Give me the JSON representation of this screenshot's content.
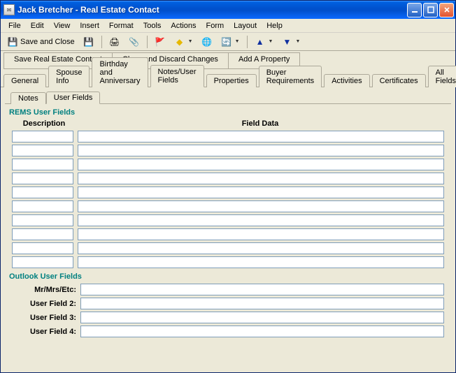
{
  "title": "Jack Bretcher - Real Estate Contact",
  "menu": [
    "File",
    "Edit",
    "View",
    "Insert",
    "Format",
    "Tools",
    "Actions",
    "Form",
    "Layout",
    "Help"
  ],
  "toolbar": {
    "save_close": "Save and Close"
  },
  "actions": {
    "save_contact": "Save Real Estate Contact",
    "close_discard": "Close and Discard Changes",
    "add_property": "Add A Property"
  },
  "tabs": [
    "General",
    "Spouse Info",
    "Birthday and Anniversary",
    "Notes/User Fields",
    "Properties",
    "Buyer Requirements",
    "Activities",
    "Certificates",
    "All Fields"
  ],
  "active_tab": "Notes/User Fields",
  "subtabs": [
    "Notes",
    "User Fields"
  ],
  "active_subtab": "User Fields",
  "rems": {
    "group_label": "REMS User Fields",
    "desc_header": "Description",
    "data_header": "Field Data",
    "rows": [
      {
        "desc": "",
        "data": ""
      },
      {
        "desc": "",
        "data": ""
      },
      {
        "desc": "",
        "data": ""
      },
      {
        "desc": "",
        "data": ""
      },
      {
        "desc": "",
        "data": ""
      },
      {
        "desc": "",
        "data": ""
      },
      {
        "desc": "",
        "data": ""
      },
      {
        "desc": "",
        "data": ""
      },
      {
        "desc": "",
        "data": ""
      },
      {
        "desc": "",
        "data": ""
      }
    ]
  },
  "outlook": {
    "group_label": "Outlook User Fields",
    "fields": [
      {
        "label": "Mr/Mrs/Etc:",
        "value": ""
      },
      {
        "label": "User Field 2:",
        "value": ""
      },
      {
        "label": "User Field 3:",
        "value": ""
      },
      {
        "label": "User Field 4:",
        "value": ""
      }
    ]
  }
}
